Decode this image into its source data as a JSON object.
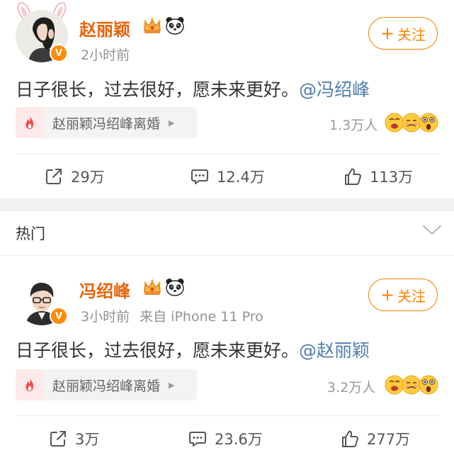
{
  "post1": {
    "username": "赵丽颖",
    "badge": "V",
    "time": "2小时前",
    "follow": {
      "plus": "+",
      "label": "关注"
    },
    "text": "日子很长，过去很好，愿未来更好。",
    "mention": "@冯绍峰",
    "topic": "赵丽颖冯绍峰离婚",
    "reacted_count": "1.3万人",
    "actions": {
      "repost": "29万",
      "comment": "12.4万",
      "like": "113万"
    }
  },
  "hot": {
    "label": "热门"
  },
  "post2": {
    "username": "冯绍峰",
    "badge": "V",
    "time": "3小时前",
    "source": "来自 iPhone 11 Pro",
    "follow": {
      "plus": "+",
      "label": "关注"
    },
    "text": "日子很长，过去很好，愿未来更好。",
    "mention": "@赵丽颖",
    "topic": "赵丽颖冯绍峰离婚",
    "reacted_count": "3.2万人",
    "actions": {
      "repost": "3万",
      "comment": "23.6万",
      "like": "277万"
    }
  },
  "icons": [
    "rabbit-ears-icon",
    "verified-v-icon",
    "crown-icon",
    "panda-icon",
    "fire-icon",
    "caret-right-icon",
    "emoji-reactions-icon",
    "repost-icon",
    "comment-icon",
    "like-icon",
    "chevron-down-icon"
  ],
  "colors": {
    "username": "#e8630c",
    "follow": "#ff8200",
    "mention": "#507daf",
    "meta": "#939393",
    "badge": "#ff8a00",
    "fire": "#f0494a"
  }
}
